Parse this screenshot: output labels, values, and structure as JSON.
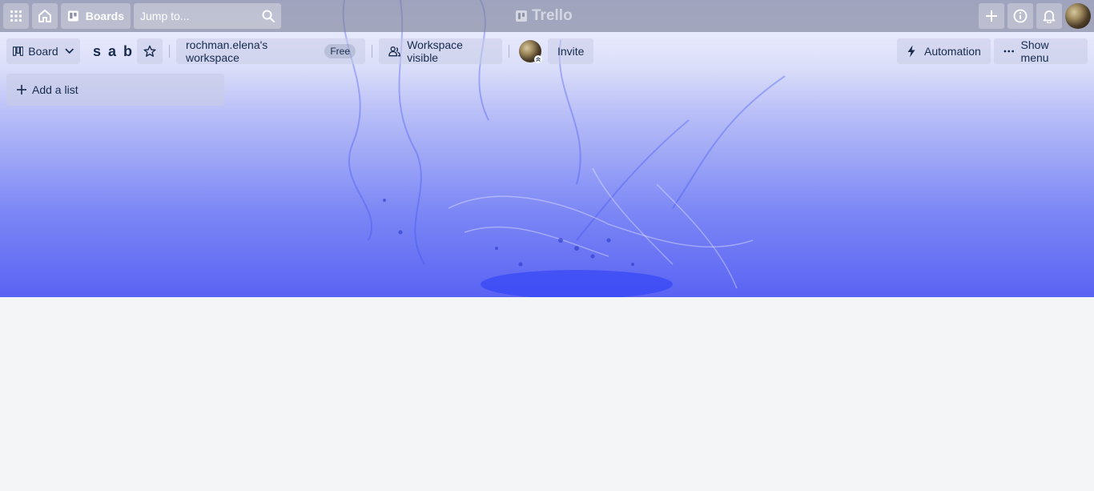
{
  "header": {
    "boards_label": "Boards",
    "search_placeholder": "Jump to...",
    "logo_text": "Trello"
  },
  "board_bar": {
    "view_label": "Board",
    "board_title": "s a b",
    "workspace_name": "rochman.elena's workspace",
    "workspace_plan": "Free",
    "visibility_label": "Workspace visible",
    "invite_label": "Invite",
    "automation_label": "Automation",
    "show_menu_label": "Show menu"
  },
  "lists": {
    "add_list_label": "Add a list"
  },
  "colors": {
    "board_background_top": "#dfe2fb",
    "board_background_bottom": "#5a63f3",
    "page_background": "#f4f5f7",
    "text_dark": "#172b4d"
  }
}
